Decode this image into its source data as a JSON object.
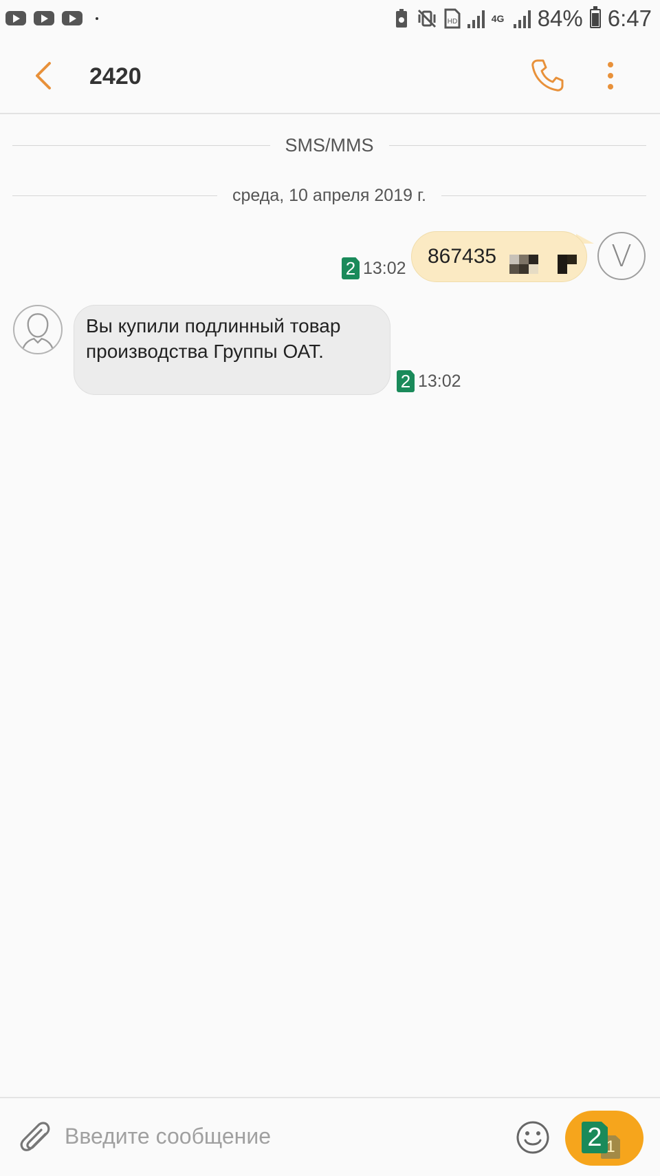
{
  "status_bar": {
    "notifications": [
      "youtube-icon",
      "youtube-icon",
      "youtube-icon"
    ],
    "battery_percent": "84%",
    "time": "6:47",
    "network": "4G"
  },
  "header": {
    "title": "2420"
  },
  "thread": {
    "channel_label": "SMS/MMS",
    "date_label": "среда, 10 апреля 2019 г.",
    "messages": [
      {
        "direction": "sent",
        "text": "867435",
        "sim": "2",
        "time": "13:02",
        "avatar_letter": "V"
      },
      {
        "direction": "received",
        "text": "Вы купили подлинный товар производства Группы ОАТ.",
        "sim": "2",
        "time": "13:02"
      }
    ]
  },
  "composer": {
    "placeholder": "Введите сообщение",
    "send_sim_primary": "2",
    "send_sim_secondary": "1"
  },
  "colors": {
    "accent": "#e8913a",
    "sent_bubble": "#fbeac3",
    "received_bubble": "#ececec",
    "sim_badge": "#1a8a5a",
    "send_button": "#f6a51c"
  }
}
